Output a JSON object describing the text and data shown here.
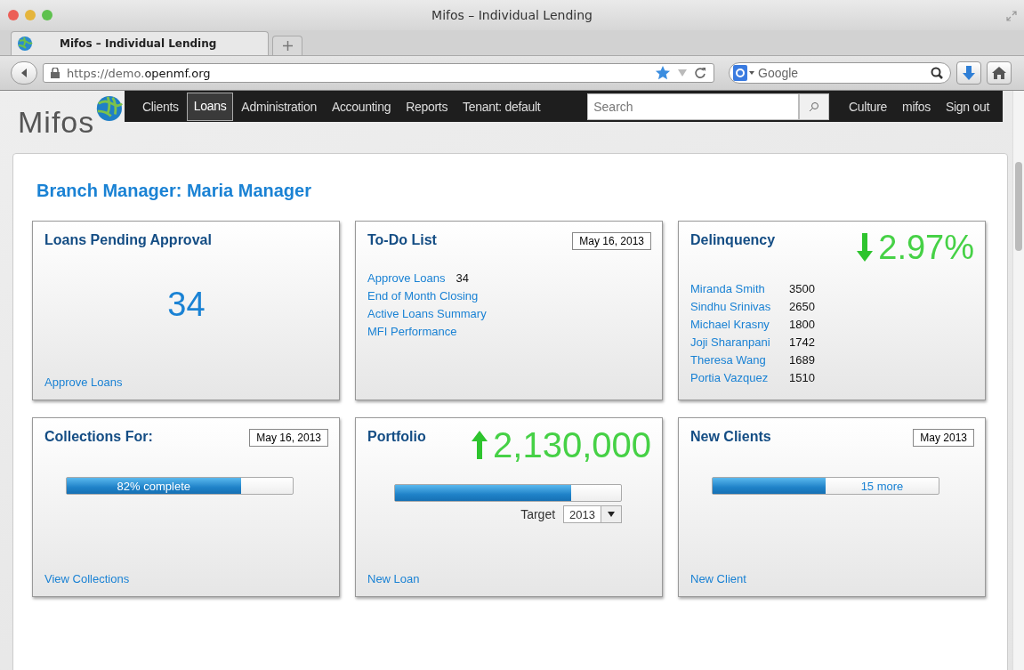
{
  "browser": {
    "window_title": "Mifos – Individual Lending",
    "tab_title": "Mifos – Individual Lending",
    "url_prefix": "https://demo.",
    "url_domain": "openmf.org",
    "search_placeholder": "Google"
  },
  "nav": {
    "logo": "Mifos",
    "items": [
      {
        "label": "Clients",
        "selected": false
      },
      {
        "label": "Loans",
        "selected": true
      },
      {
        "label": "Administration",
        "selected": false
      },
      {
        "label": "Accounting",
        "selected": false
      },
      {
        "label": "Reports",
        "selected": false
      },
      {
        "label": "Tenant: default",
        "selected": false
      }
    ],
    "search_placeholder": "Search",
    "right_links": [
      "Culture",
      "mifos",
      "Sign out"
    ]
  },
  "page_title": "Branch Manager: Maria Manager",
  "cards": [
    {
      "kind": "big_number",
      "title": "Loans Pending Approval",
      "value": "34",
      "link": "Approve Loans"
    },
    {
      "kind": "todo",
      "title": "To-Do List",
      "date": "May 16, 2013",
      "items": [
        {
          "label": "Approve Loans",
          "count": "34"
        },
        {
          "label": "End of Month Closing"
        },
        {
          "label": "Active Loans Summary"
        },
        {
          "label": "MFI Performance"
        }
      ]
    },
    {
      "kind": "delinquency",
      "title": "Delinquency",
      "trend_up": false,
      "value": "2.97%",
      "rows": [
        {
          "name": "Miranda Smith",
          "amount": "3500"
        },
        {
          "name": "Sindhu Srinivas",
          "amount": "2650"
        },
        {
          "name": "Michael Krasny",
          "amount": "1800"
        },
        {
          "name": "Joji Sharanpani",
          "amount": "1742"
        },
        {
          "name": "Theresa Wang",
          "amount": "1689"
        },
        {
          "name": "Portia Vazquez",
          "amount": "1510"
        }
      ]
    },
    {
      "kind": "progress",
      "title": "Collections For:",
      "date": "May 16, 2013",
      "level": 0.77,
      "bar_label": "82% complete",
      "label_on_fill": true,
      "link": "View Collections"
    },
    {
      "kind": "portfolio",
      "title": "Portfolio",
      "trend_up": true,
      "value": "2,130,000",
      "level": 0.78,
      "target_label": "Target",
      "target_value": "2013",
      "link": "New Loan"
    },
    {
      "kind": "progress",
      "title": "New Clients",
      "date": "May 2013",
      "level": 0.5,
      "bar_label": "15 more",
      "label_on_fill": false,
      "link": "New Client"
    }
  ]
}
